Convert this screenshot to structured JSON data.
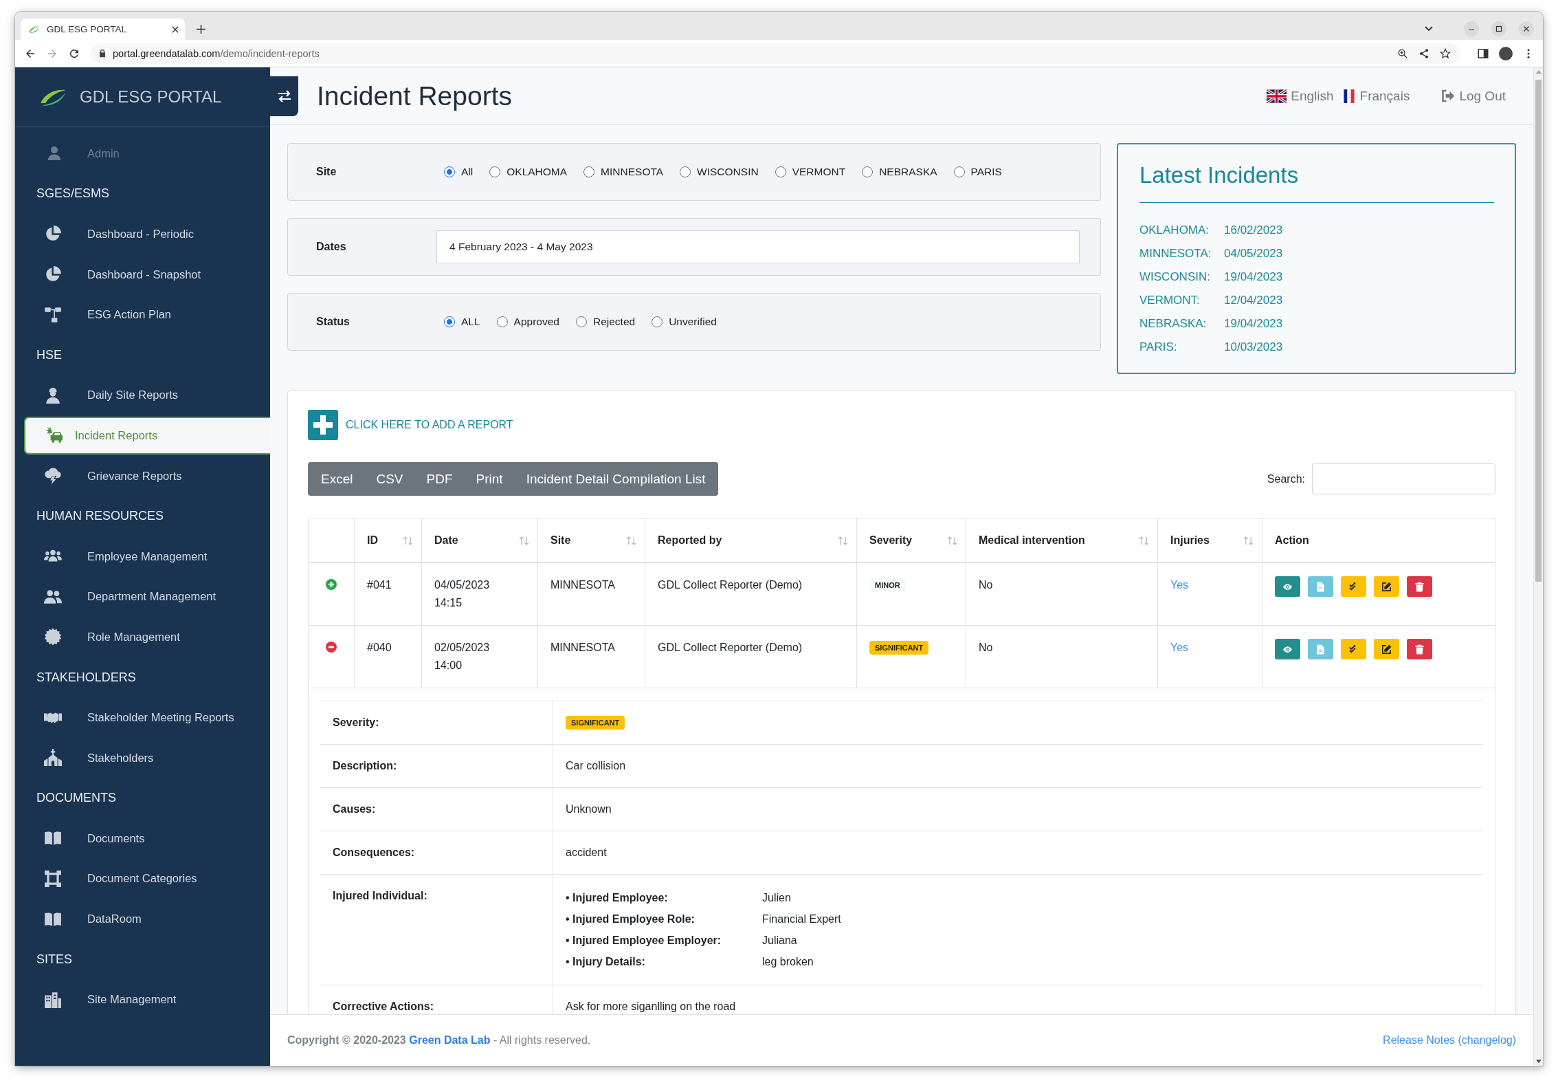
{
  "browser": {
    "tab_title": "GDL ESG PORTAL",
    "url_host": "portal.greendatalab.com",
    "url_path": "/demo/incident-reports",
    "forward_disabled": true
  },
  "sidebar": {
    "brand": "GDL ESG PORTAL",
    "user": "Admin",
    "sections": [
      {
        "title": "SGES/ESMS",
        "items": [
          {
            "label": "Dashboard - Periodic",
            "selected": false
          },
          {
            "label": "Dashboard - Snapshot",
            "selected": false
          },
          {
            "label": "ESG Action Plan",
            "selected": false
          }
        ]
      },
      {
        "title": "HSE",
        "items": [
          {
            "label": "Daily Site Reports",
            "selected": false
          },
          {
            "label": "Incident Reports",
            "selected": true
          },
          {
            "label": "Grievance Reports",
            "selected": false
          }
        ]
      },
      {
        "title": "HUMAN RESOURCES",
        "items": [
          {
            "label": "Employee Management",
            "selected": false
          },
          {
            "label": "Department Management",
            "selected": false
          },
          {
            "label": "Role Management",
            "selected": false
          }
        ]
      },
      {
        "title": "STAKEHOLDERS",
        "items": [
          {
            "label": "Stakeholder Meeting Reports",
            "selected": false
          },
          {
            "label": "Stakeholders",
            "selected": false
          }
        ]
      },
      {
        "title": "DOCUMENTS",
        "items": [
          {
            "label": "Documents",
            "selected": false
          },
          {
            "label": "Document Categories",
            "selected": false
          },
          {
            "label": "DataRoom",
            "selected": false
          }
        ]
      },
      {
        "title": "SITES",
        "items": [
          {
            "label": "Site Management",
            "selected": false
          }
        ]
      }
    ]
  },
  "header": {
    "title": "Incident Reports",
    "languages": [
      {
        "label": "English"
      },
      {
        "label": "Français"
      }
    ],
    "logout": "Log Out"
  },
  "filters": [
    {
      "kind": "radio",
      "label": "Site",
      "options": [
        {
          "label": "All",
          "selected": true
        },
        {
          "label": "OKLAHOMA",
          "selected": false
        },
        {
          "label": "MINNESOTA",
          "selected": false
        },
        {
          "label": "WISCONSIN",
          "selected": false
        },
        {
          "label": "VERMONT",
          "selected": false
        },
        {
          "label": "NEBRASKA",
          "selected": false
        },
        {
          "label": "PARIS",
          "selected": false
        }
      ]
    },
    {
      "kind": "date",
      "label": "Dates",
      "value": "4 February 2023 - 4 May 2023"
    },
    {
      "kind": "radio",
      "label": "Status",
      "options": [
        {
          "label": "ALL",
          "selected": true
        },
        {
          "label": "Approved",
          "selected": false
        },
        {
          "label": "Rejected",
          "selected": false
        },
        {
          "label": "Unverified",
          "selected": false
        }
      ]
    }
  ],
  "latest_incidents": {
    "title": "Latest Incidents",
    "entries": [
      {
        "site": "OKLAHOMA:",
        "date": "16/02/2023"
      },
      {
        "site": "MINNESOTA:",
        "date": "04/05/2023"
      },
      {
        "site": "WISCONSIN:",
        "date": "19/04/2023"
      },
      {
        "site": "VERMONT:",
        "date": "12/04/2023"
      },
      {
        "site": "NEBRASKA:",
        "date": "19/04/2023"
      },
      {
        "site": "PARIS:",
        "date": "10/03/2023"
      }
    ]
  },
  "reports": {
    "add_report": "CLICK HERE TO ADD A REPORT",
    "export_buttons": [
      "Excel",
      "CSV",
      "PDF",
      "Print",
      "Incident Detail Compilation List"
    ],
    "search": {
      "label": "Search:"
    },
    "table": {
      "columns": [
        {
          "label": "ID",
          "sortable": true
        },
        {
          "label": "Date",
          "sortable": true
        },
        {
          "label": "Site",
          "sortable": true
        },
        {
          "label": "Reported by",
          "sortable": true
        },
        {
          "label": "Severity",
          "sortable": true
        },
        {
          "label": "Medical intervention",
          "sortable": true
        },
        {
          "label": "Injuries",
          "sortable": true
        },
        {
          "label": "Action",
          "sortable": false
        }
      ],
      "rows": [
        {
          "expanded": false,
          "id": "#041",
          "date": "04/05/2023 14:15",
          "site": "MINNESOTA",
          "reported_by": "GDL Collect Reporter (Demo)",
          "severity": {
            "label": "MINOR",
            "color": "#f8f9fa"
          },
          "medical_intervention": "No",
          "injuries": "Yes"
        },
        {
          "expanded": true,
          "id": "#040",
          "date": "02/05/2023 14:00",
          "site": "MINNESOTA",
          "reported_by": "GDL Collect Reporter (Demo)",
          "severity": {
            "label": "SIGNIFICANT",
            "color": "#ffc107"
          },
          "medical_intervention": "No",
          "injuries": "Yes",
          "details": [
            {
              "kind": "badge",
              "label": "Severity:",
              "badge": {
                "label": "SIGNIFICANT",
                "color": "#ffc107"
              }
            },
            {
              "kind": "text",
              "label": "Description:",
              "value": "Car collision"
            },
            {
              "kind": "text",
              "label": "Causes:",
              "value": "Unknown"
            },
            {
              "kind": "text",
              "label": "Consequences:",
              "value": "accident"
            },
            {
              "kind": "list",
              "label": "Injured Individual:",
              "items": [
                {
                  "label": "• Injured Employee:",
                  "value": "Julien"
                },
                {
                  "label": "• Injured Employee Role:",
                  "value": "Financial Expert"
                },
                {
                  "label": "• Injured Employee Employer:",
                  "value": "Juliana"
                },
                {
                  "label": "• Injury Details:",
                  "value": "leg broken"
                }
              ]
            },
            {
              "kind": "text",
              "label": "Corrective Actions:",
              "value": "Ask for more siganlling on the road"
            }
          ]
        }
      ]
    }
  },
  "footer": {
    "copyright": "Copyright © 2020-2023",
    "company": "Green Data Lab",
    "rights": "- All rights reserved.",
    "release_notes": "Release Notes (changelog)"
  }
}
